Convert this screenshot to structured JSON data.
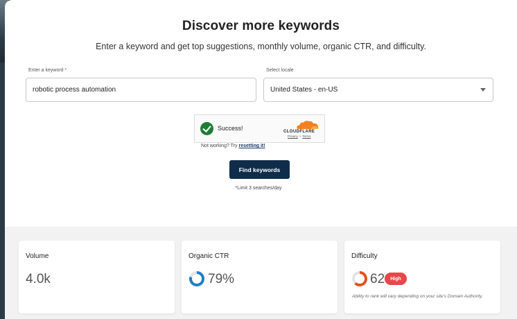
{
  "header": {
    "title": "Discover more keywords",
    "subtitle": "Enter a keyword and get top suggestions, monthly volume, organic CTR, and difficulty."
  },
  "form": {
    "keyword_label": "Enter a keyword",
    "keyword_required": "*",
    "keyword_value": "robotic process automation",
    "locale_label": "Select locale",
    "locale_value": "United States - en-US",
    "captcha_status": "Success!",
    "captcha_brand": "CLOUDFLARE",
    "captcha_privacy": "Privacy",
    "captcha_sep": "•",
    "captcha_terms": "Terms",
    "not_working_text": "Not working? Try",
    "resetting_link": "resetting it!",
    "submit_label": "Find keywords",
    "limit_note": "*Limit 3 searches/day"
  },
  "stats": {
    "volume_label": "Volume",
    "volume_value": "4.0k",
    "ctr_label": "Organic CTR",
    "ctr_value": "79%",
    "ctr_fraction": 0.79,
    "ctr_color": "#1e7fc4",
    "difficulty_label": "Difficulty",
    "difficulty_value": "62",
    "difficulty_fraction": 0.62,
    "difficulty_color": "#e0531f",
    "difficulty_badge": "High",
    "difficulty_note": "Ability to rank will vary depending on your site's Domain Authority."
  }
}
